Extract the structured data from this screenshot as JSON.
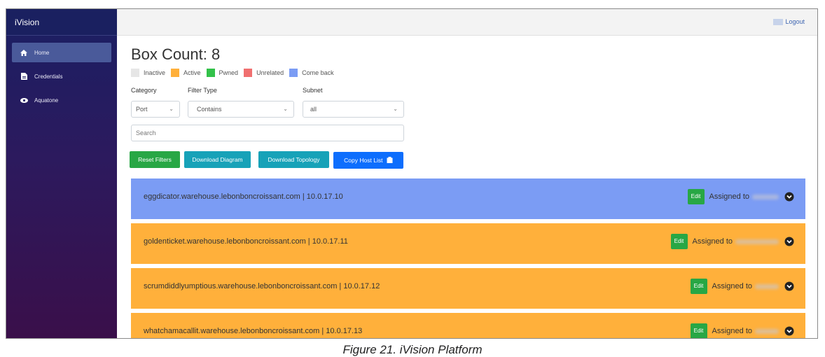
{
  "app": {
    "brand": "iVision"
  },
  "sidebar": {
    "items": [
      {
        "label": "Home",
        "icon": "home-icon",
        "active": true
      },
      {
        "label": "Credentials",
        "icon": "document-icon",
        "active": false
      },
      {
        "label": "Aquatone",
        "icon": "eye-icon",
        "active": false
      }
    ]
  },
  "topbar": {
    "logout_label": "Logout"
  },
  "main": {
    "title": "Box Count: 8",
    "legend": [
      {
        "label": "Inactive",
        "color": "#e6e6e6"
      },
      {
        "label": "Active",
        "color": "#ffb03b"
      },
      {
        "label": "Pwned",
        "color": "#33c24a"
      },
      {
        "label": "Unrelated",
        "color": "#f07070"
      },
      {
        "label": "Come back",
        "color": "#7b9cf4"
      }
    ],
    "filters": {
      "category_label": "Category",
      "category_value": "Port",
      "filter_type_label": "Filter Type",
      "filter_type_value": "Contains",
      "subnet_label": "Subnet",
      "subnet_value": "all",
      "search_placeholder": "Search"
    },
    "buttons": {
      "reset": "Reset Filters",
      "download_diagram": "Download Diagram",
      "download_topology": "Download Topology",
      "copy_host_list": "Copy Host List"
    },
    "hosts": [
      {
        "host": "eggdicator.warehouse.lebonboncroissant.com | 10.0.17.10",
        "status_color": "#7b9cf4",
        "edit": "Edit",
        "assigned": "Assigned to"
      },
      {
        "host": "goldenticket.warehouse.lebonboncroissant.com | 10.0.17.11",
        "status_color": "#ffb03b",
        "edit": "Edit",
        "assigned": "Assigned to"
      },
      {
        "host": "scrumdiddlyumptious.warehouse.lebonboncroissant.com | 10.0.17.12",
        "status_color": "#ffb03b",
        "edit": "Edit",
        "assigned": "Assigned to"
      },
      {
        "host": "whatchamacallit.warehouse.lebonboncroissant.com | 10.0.17.13",
        "status_color": "#ffb03b",
        "edit": "Edit",
        "assigned": "Assigned to"
      }
    ]
  },
  "caption": "Figure 21. iVision Platform"
}
